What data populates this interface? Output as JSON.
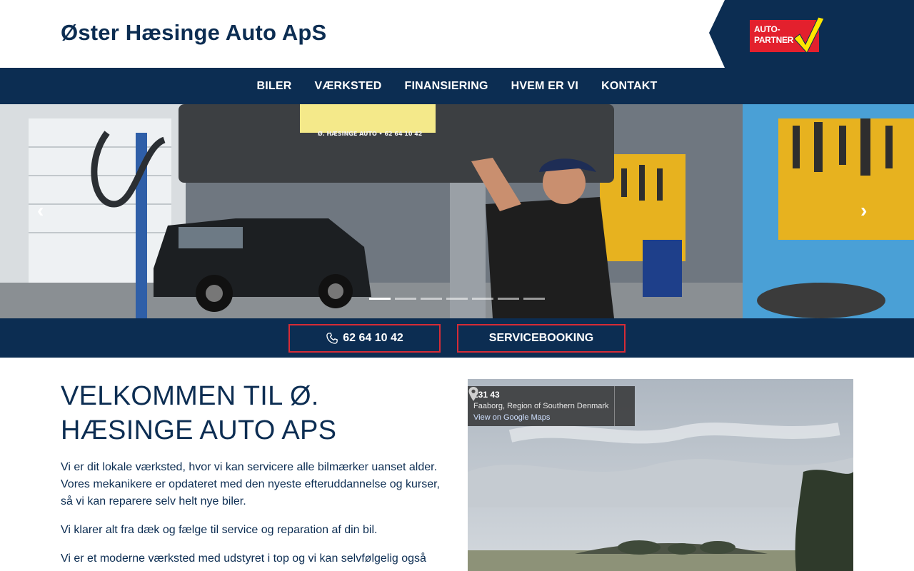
{
  "header": {
    "site_title": "Øster Hæsinge Auto ApS",
    "logo_line1": "AUTO-",
    "logo_line2": "PARTNER",
    "logo_color": "#e3202d",
    "check_color": "#ffe600"
  },
  "nav": {
    "items": [
      "BILER",
      "VÆRKSTED",
      "FINANSIERING",
      "HVEM ER VI",
      "KONTAKT"
    ]
  },
  "hero": {
    "plate_text": "Ø. HÆSINGE AUTO • 62 64 10 42",
    "prev_icon": "‹",
    "next_icon": "›",
    "slide_count": 7,
    "active_slide": 1
  },
  "cta": {
    "phone": "62 64 10 42",
    "booking": "SERVICEBOOKING"
  },
  "content": {
    "heading": "VELKOMMEN TIL Ø. HÆSINGE AUTO APS",
    "p1": "Vi er dit lokale værksted, hvor vi kan servicere alle bilmærker uanset alder. Vores mekanikere er opdateret med den nyeste efteruddannelse og kurser, så vi kan reparere selv helt nye biler.",
    "p2": "Vi klarer alt fra dæk og fælge til service og reparation af din bil.",
    "p3": "Vi er et moderne værksted med udstyret i top og vi kan selvfølgelig også"
  },
  "map": {
    "title": "231 43",
    "subtitle": "Faaborg, Region of Southern Denmark",
    "link": "View on Google Maps"
  },
  "colors": {
    "navy": "#0c2d52",
    "accent_red": "#d62b36"
  }
}
